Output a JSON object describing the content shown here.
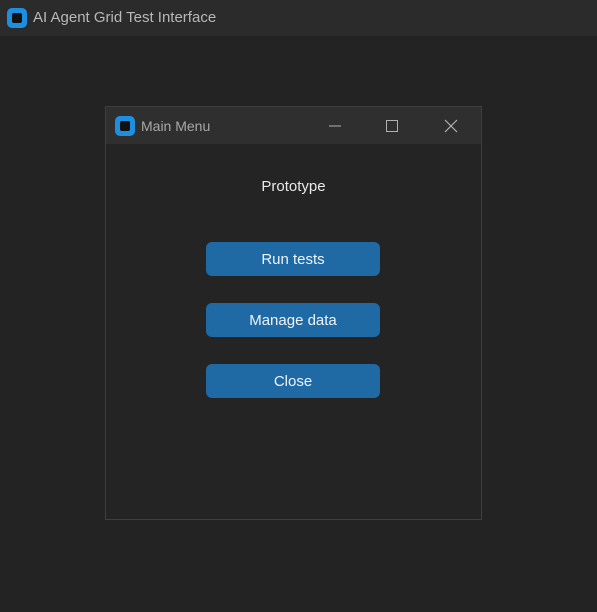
{
  "app": {
    "title": "AI Agent Grid Test Interface"
  },
  "dialog": {
    "title": "Main Menu",
    "heading": "Prototype",
    "buttons": {
      "run_tests": "Run tests",
      "manage_data": "Manage data",
      "close": "Close"
    }
  },
  "icons": {
    "app_logo": "app-logo-icon",
    "minimize": "minimize-icon",
    "maximize": "maximize-icon",
    "close": "close-icon"
  },
  "colors": {
    "accent": "#1f6aa5",
    "logo": "#1e8fe0",
    "background": "#232323"
  }
}
